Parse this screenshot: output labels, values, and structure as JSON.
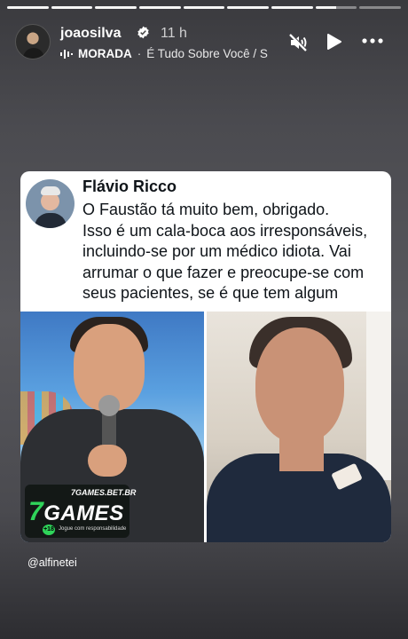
{
  "story": {
    "segments": [
      "done",
      "done",
      "done",
      "done",
      "active",
      "todo",
      "todo",
      "todo",
      "todo"
    ]
  },
  "header": {
    "username": "joaosilva",
    "time": "11 h",
    "music": {
      "artist": "MORADA",
      "separator": "·",
      "song": "É Tudo Sobre Você / S"
    },
    "icons": {
      "verified": "verified-badge-icon",
      "mute": "mute-icon",
      "play": "play-icon",
      "more": "more-icon",
      "music": "sound-wave-icon"
    }
  },
  "tweet": {
    "author": "Flávio Ricco",
    "lines": [
      "O Faustão tá muito bem, obrigado.",
      "Isso é um cala-boca aos irresponsáveis,",
      "incluindo-se por um médico idiota. Vai",
      "arrumar o que fazer e preocupe-se com",
      "seus pacientes, se é que tem algum"
    ]
  },
  "ad": {
    "site": "7GAMES.BET.BR",
    "logo_seven": "7",
    "logo_rest": "GAMES",
    "age": "+18",
    "note": "Jogue com responsabilidade"
  },
  "mention": "@alfinetei",
  "colors": {
    "verified": "#ffffff",
    "games_green": "#2fd45a"
  }
}
